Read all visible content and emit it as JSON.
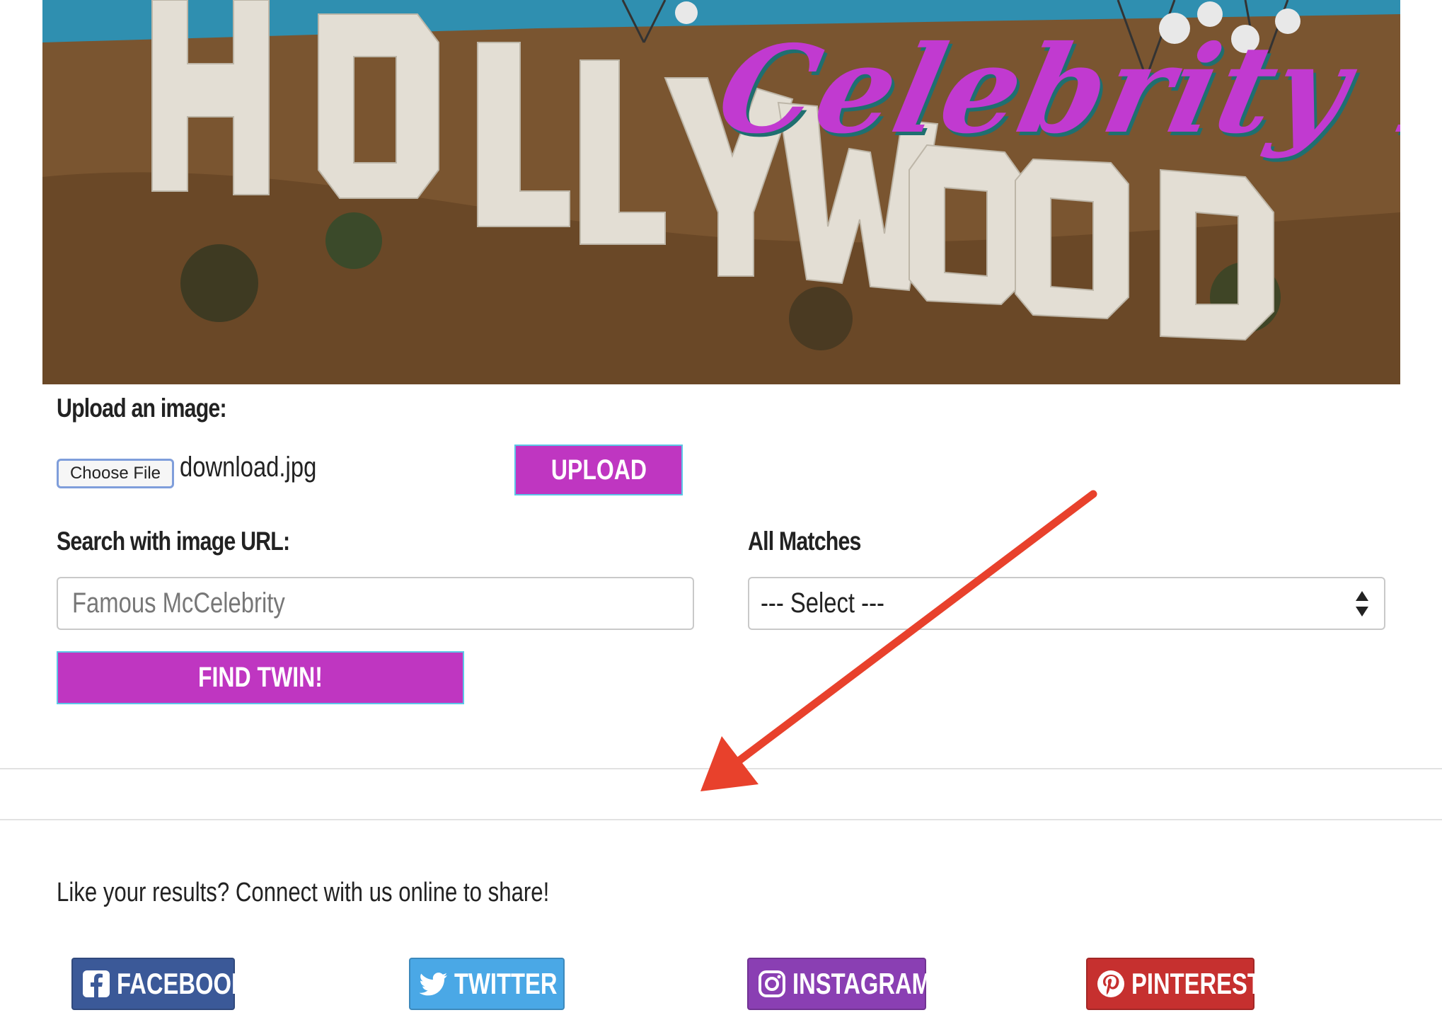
{
  "hero": {
    "title": "Celebrity Twin!",
    "sign_text": "HOLLYWOOD"
  },
  "upload": {
    "label": "Upload an image:",
    "choose_file_label": "Choose File",
    "file_name": "download.jpg",
    "upload_button": "UPLOAD"
  },
  "search": {
    "label": "Search with image URL:",
    "placeholder": "Famous McCelebrity",
    "find_button": "FIND TWIN!"
  },
  "matches": {
    "label": "All Matches",
    "selected": "--- Select ---"
  },
  "share": {
    "text": "Like your results? Connect with us online to share!",
    "buttons": [
      {
        "label": "FACEBOOK",
        "icon": "facebook-icon",
        "color": "#3b5998"
      },
      {
        "label": "TWITTER",
        "icon": "twitter-icon",
        "color": "#4aa8e6"
      },
      {
        "label": "INSTAGRAM",
        "icon": "instagram-icon",
        "color": "#8a3fb3"
      },
      {
        "label": "PINTEREST",
        "icon": "pinterest-icon",
        "color": "#c6302f"
      }
    ]
  },
  "colors": {
    "accent": "#bf36c1",
    "annotation_arrow": "#e8412c"
  }
}
